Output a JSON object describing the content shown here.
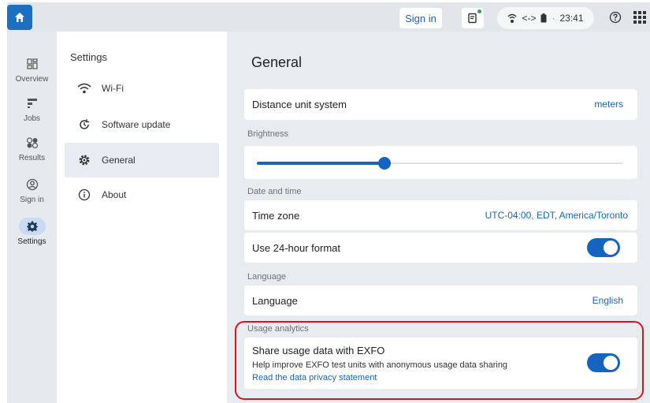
{
  "topbar": {
    "signin_label": "Sign in",
    "time": "23:41",
    "status_sep": "·",
    "link_glyph": "<->"
  },
  "rail": {
    "items": [
      {
        "label": "Overview",
        "icon": "dashboard-icon"
      },
      {
        "label": "Jobs",
        "icon": "jobs-icon"
      },
      {
        "label": "Results",
        "icon": "results-icon"
      },
      {
        "label": "Sign in",
        "icon": "account-icon"
      },
      {
        "label": "Settings",
        "icon": "settings-gear-icon",
        "active": true
      }
    ]
  },
  "settings_menu": {
    "title": "Settings",
    "items": [
      {
        "label": "Wi-Fi",
        "icon": "wifi-icon"
      },
      {
        "label": "Software update",
        "icon": "update-icon"
      },
      {
        "label": "General",
        "icon": "gear-icon",
        "selected": true
      },
      {
        "label": "About",
        "icon": "info-icon"
      }
    ]
  },
  "general": {
    "title": "General",
    "distance": {
      "label": "Distance unit system",
      "value": "meters"
    },
    "brightness": {
      "section": "Brightness",
      "level_percent": 35
    },
    "date_time": {
      "section": "Date and time",
      "timezone_label": "Time zone",
      "timezone_value": "UTC-04:00, EDT, America/Toronto",
      "format_label": "Use 24-hour format",
      "format_on": true
    },
    "language": {
      "section": "Language",
      "label": "Language",
      "value": "English"
    },
    "analytics": {
      "section": "Usage analytics",
      "label": "Share usage data with EXFO",
      "description": "Help improve EXFO test units with anonymous usage data sharing",
      "link": "Read the data privacy statement",
      "on": true
    }
  },
  "colors": {
    "accent": "#1565c0",
    "highlight": "#d5161c"
  }
}
